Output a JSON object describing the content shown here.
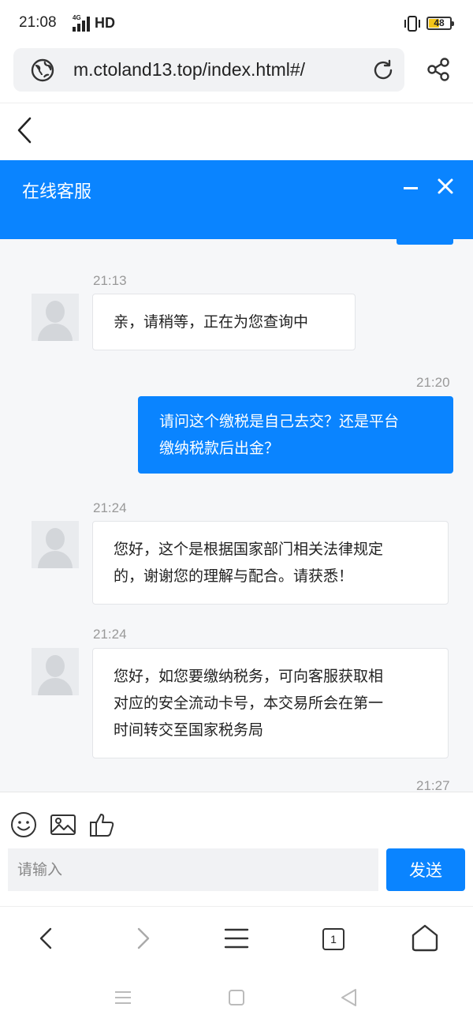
{
  "status_bar": {
    "time": "21:08",
    "network": "4G",
    "hd": "HD",
    "battery": "48",
    "battery_level": 0.48
  },
  "browser": {
    "url": "m.ctoland13.top/index.html#/",
    "tabs_count": "1"
  },
  "chat": {
    "title": "在线客服",
    "messages": [
      {
        "side": "in",
        "time": "21:13",
        "lines": [
          "亲，请稍等，正在为您查询中"
        ]
      },
      {
        "side": "out",
        "time": "21:20",
        "lines": [
          "请问这个缴税是自己去交？还是平台",
          "缴纳税款后出金？"
        ]
      },
      {
        "side": "in",
        "time": "21:24",
        "lines": [
          "您好，这个是根据国家部门相关法律规定",
          "的，谢谢您的理解与配合。请获悉！"
        ]
      },
      {
        "side": "in",
        "time": "21:24",
        "lines": [
          "您好，如您要缴纳税务，可向客服获取相",
          "对应的安全流动卡号，本交易所会在第一",
          "时间转交至国家税务局"
        ]
      },
      {
        "side": "out",
        "time": "21:27",
        "lines": []
      }
    ]
  },
  "composer": {
    "placeholder": "请输入",
    "send_label": "发送"
  },
  "colors": {
    "accent": "#0a84ff",
    "chat_bg": "#f6f7f9"
  }
}
